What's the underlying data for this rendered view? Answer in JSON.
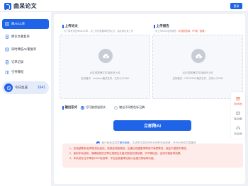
{
  "header": {
    "logo_text": "曲呆论文",
    "login_label": "登录"
  },
  "sidebar": {
    "items": [
      {
        "label": "降AIGC率",
        "icon": "rewrite-icon",
        "active": true
      },
      {
        "label": "降论文重复率",
        "icon": "document-icon",
        "active": false
      },
      {
        "label": "同时降低AI/重复率",
        "icon": "layers-icon",
        "active": false
      },
      {
        "label": "订单记录",
        "icon": "order-icon",
        "active": false
      },
      {
        "label": "引导教程",
        "icon": "book-icon",
        "active": false
      }
    ],
    "today": {
      "label": "今日生成",
      "count": "1641"
    }
  },
  "main": {
    "paper": {
      "title": "上传论文",
      "hint": "为了降低重复率/AIGC率，请上传您需要降低的论文，建议带目录上传",
      "line1": "点击或拖拽文件到此处上传",
      "line2": "支持格式：doc/docx格式文件，文件小于15M"
    },
    "report": {
      "title": "上传报告",
      "hint_prefix": "请上传AIGC检测报告",
      "hint_red": "（可选如知网、PP版、维普）",
      "line1": "点击或拖拽文件到此处上传",
      "line2": "支持格式：PDF/HTML格式文件，文件小于15M"
    },
    "output": {
      "label": "输出形式",
      "option1": "尽可能保留原文",
      "option2": "输出不同颜色标记稿",
      "selected": 0
    },
    "generate_label": "立即降AI",
    "agree": {
      "prefix": "我已阅读并同意",
      "link": "服务条款",
      "suffix": "，生成的文章仅可作为您的学术参考，不代为完成文章降低"
    },
    "notice": [
      "1、实测被降前/后降的变化曲线，按规定收取费用，如遇出现重复率降低不满意情况，保证只退费不降低。",
      "2、使用本系统前，请确保您的文章已按照论文格式规范完成标题、字节等检查，否则可能影响效果。",
      "3、本系统专注于降低AIGC检测率，不包含查重率检测以及格式排版等功能。"
    ]
  },
  "float_panel": [
    {
      "label": "限时特惠",
      "icon": "gift-icon",
      "red": true
    },
    {
      "label": "联系客服",
      "icon": "chat-icon",
      "red": false
    },
    {
      "label": "意见反馈",
      "icon": "headset-icon",
      "red": false
    }
  ],
  "colors": {
    "accent": "#1f63e8",
    "notice_bg": "#fdecea",
    "notice_text": "#d9412c"
  }
}
